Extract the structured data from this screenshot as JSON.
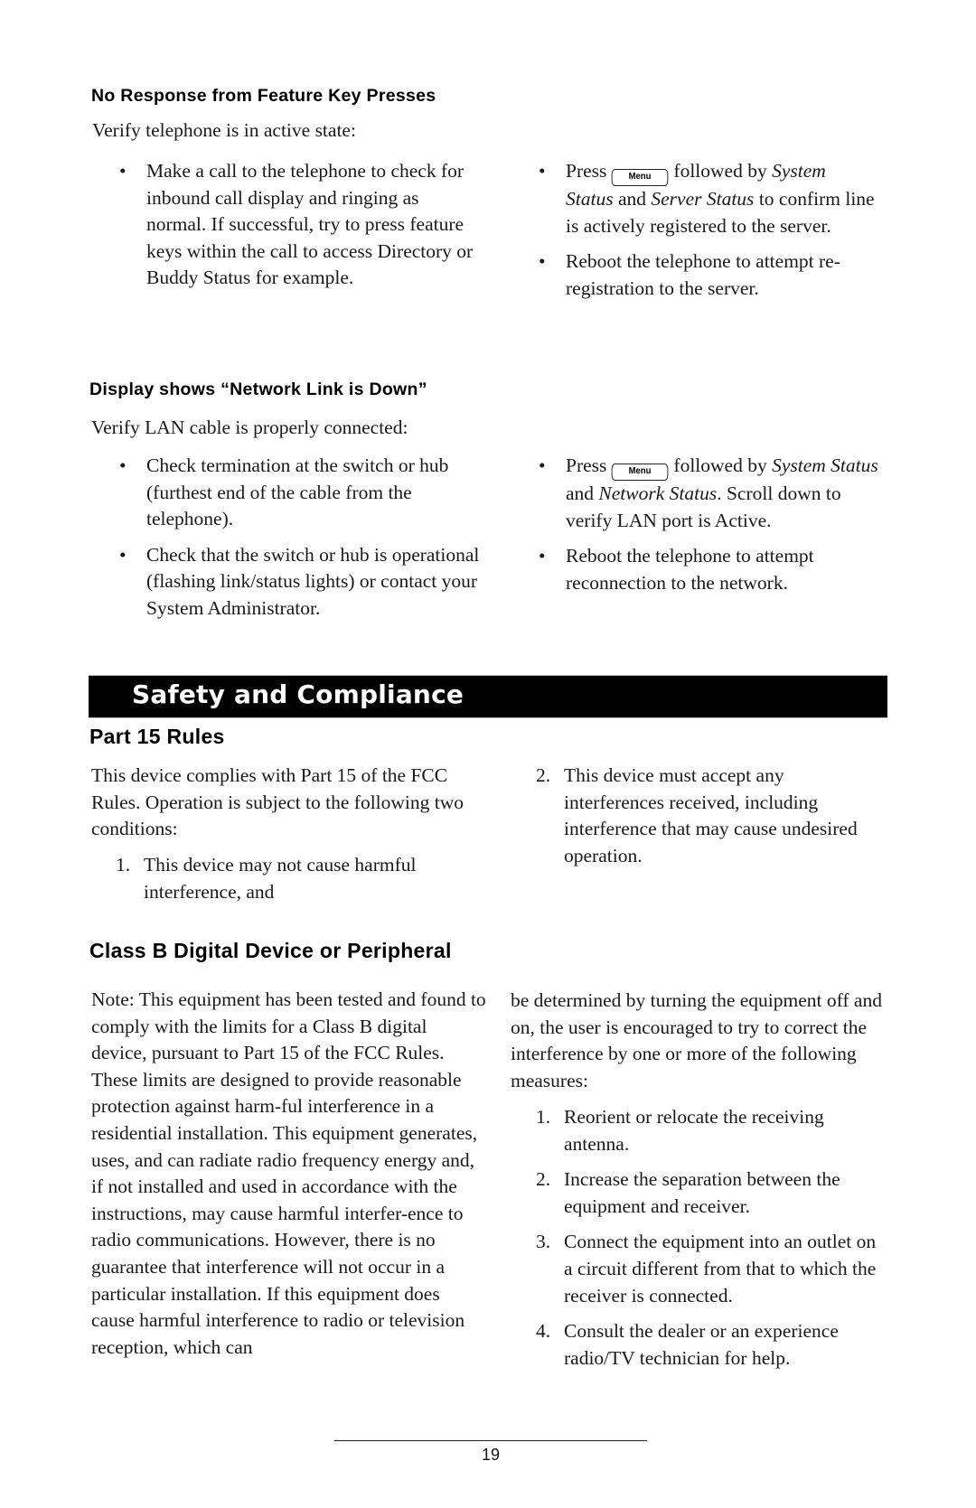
{
  "sections": {
    "no_response": {
      "heading": "No Response from Feature Key Presses",
      "intro": "Verify telephone is in active state:",
      "left_bullets": [
        "Make a call to the telephone to check for inbound call display and ringing as normal.  If successful, try to press feature keys within the call to access Directory or Buddy Status for example."
      ],
      "right_bullets": [
        {
          "pre": "Press",
          "key": "Menu",
          "mid1": "followed by",
          "em1": "System Status",
          "mid2": "and",
          "em2": "Server Status",
          "post": "to confirm line is actively registered to the server."
        },
        {
          "text": "Reboot the telephone to attempt re-registration to the server."
        }
      ]
    },
    "network_down": {
      "heading": "Display shows “Network Link is Down”",
      "intro": "Verify LAN cable is properly connected:",
      "left_bullets": [
        "Check termination at the switch or hub (furthest end of the cable from the telephone).",
        "Check that the switch or hub is operational (flashing link/status lights) or contact your System Administrator."
      ],
      "right_bullets": [
        {
          "pre": "Press",
          "key": "Menu",
          "mid1": "followed by",
          "em1": "System Status",
          "mid2": "and",
          "em2": "Network Status",
          "post": ".  Scroll down to verify LAN port is Active."
        },
        {
          "text": "Reboot the telephone to attempt reconnection to the network."
        }
      ]
    },
    "safety_bar": {
      "title": "Safety and Compliance"
    },
    "part15": {
      "heading": "Part 15 Rules",
      "intro": "This device complies with Part 15 of the FCC Rules.  Operation is subject to the following two conditions:",
      "items": [
        {
          "num": "1.",
          "text": "This device may not cause harmful interference, and"
        },
        {
          "num": "2.",
          "text": "This device must accept any interferences received, including interference that may cause undesired operation."
        }
      ]
    },
    "class_b": {
      "heading": "Class B Digital Device or Peripheral",
      "note": "Note:  This equipment has been tested and found to comply with the limits for a Class B digital device, pursuant to Part 15 of the FCC Rules.  These limits are designed to provide reasonable protection against harmful interference in a residential installation. This equipment generates, uses, and can radiate radio frequency energy and, if not installed and used in accordance with the instructions, may cause harmful interference to radio communications.  However, there is no guarantee that interference will not occur in a particular installation.  If this equipment does cause harmful interference to radio or television reception, which can be determined by turning the equipment off and on, the user is encouraged to try to correct the interference by one or more of the following measures:",
      "note_left": "Note:  This equipment has been tested and found to comply with the limits for a Class B digital device, pursuant to Part 15 of the FCC Rules.  These limits are designed to provide reasonable protection against harm-ful interference in a residential installation. This equipment generates, uses, and can radiate radio frequency energy and, if not installed and used in accordance with the instructions, may cause harmful interfer-ence to radio communications.  However, there is no guarantee that interference will not occur in a particular installation.  If this equipment does cause harmful interference to radio or television reception, which can",
      "note_right": "be determined by turning the equipment off and on, the user is encouraged to try to correct the interference by one or more of the following measures:",
      "measures": [
        {
          "num": "1.",
          "text": "Reorient or relocate the receiving antenna."
        },
        {
          "num": "2.",
          "text": "Increase the separation between the equipment and receiver."
        },
        {
          "num": "3.",
          "text": "Connect the equipment into an outlet on a circuit different from that to which the receiver is connected."
        },
        {
          "num": "4.",
          "text": "Consult the dealer or an experience radio/TV technician for help."
        }
      ]
    }
  },
  "footer": {
    "page_number": "19"
  },
  "icons": {
    "bullet": "•",
    "menu_key": "menu-key-icon"
  }
}
